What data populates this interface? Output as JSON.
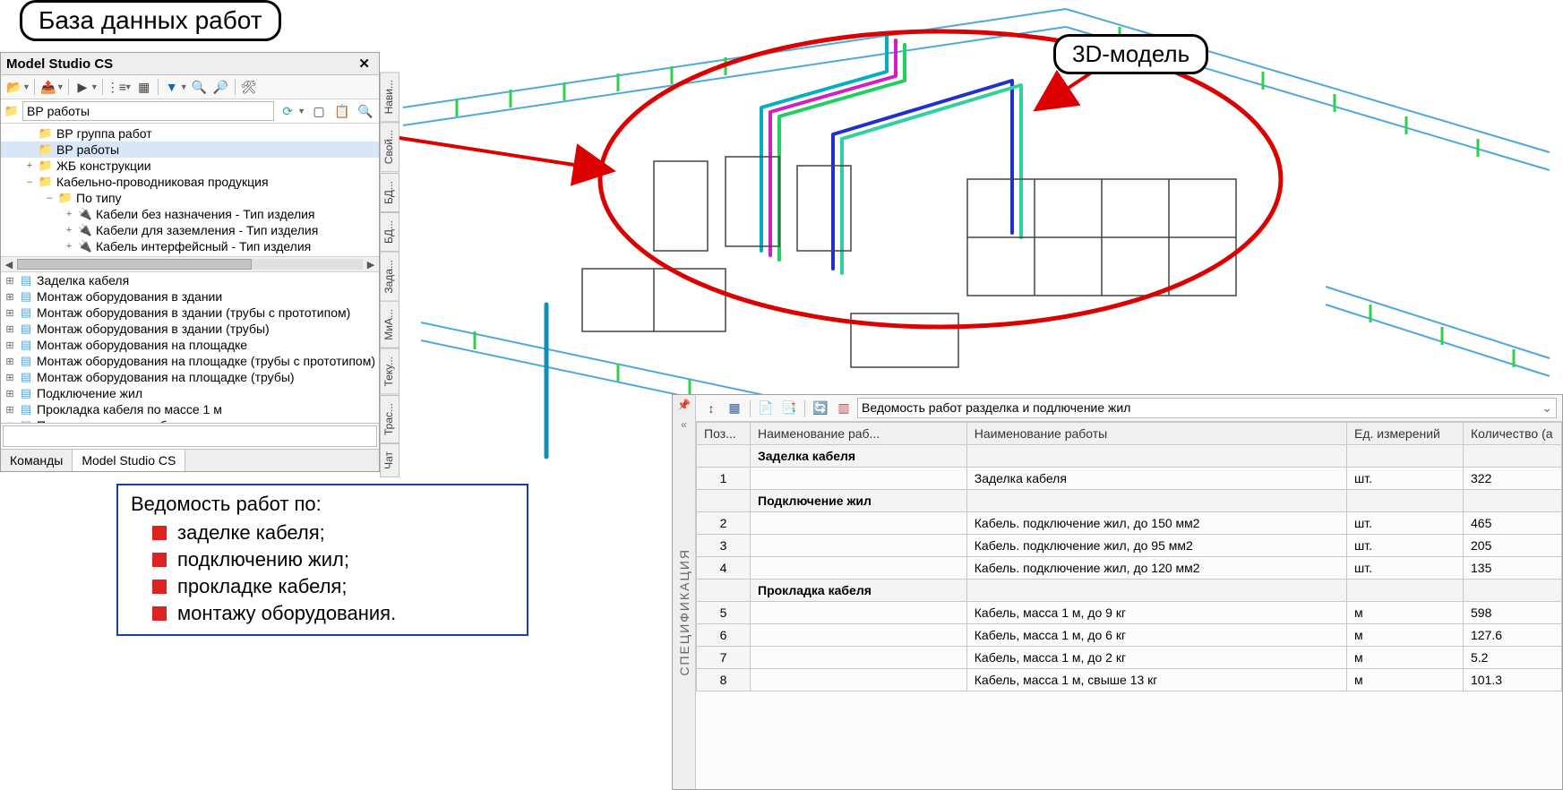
{
  "callouts": {
    "database": "База данных работ",
    "model3d": "3D-модель"
  },
  "panel": {
    "title": "Model Studio CS",
    "search_value": "ВР работы",
    "tree": [
      {
        "lvl": 1,
        "icon": "folder",
        "toggle": "",
        "label": "ВР группа работ"
      },
      {
        "lvl": 1,
        "icon": "folder",
        "toggle": "",
        "label": "ВР работы",
        "sel": true
      },
      {
        "lvl": 1,
        "icon": "folder",
        "toggle": "+",
        "label": "ЖБ конструкции"
      },
      {
        "lvl": 1,
        "icon": "folder",
        "toggle": "–",
        "label": "Кабельно-проводниковая продукция"
      },
      {
        "lvl": 2,
        "icon": "folder",
        "toggle": "–",
        "label": "По типу"
      },
      {
        "lvl": 3,
        "icon": "cable",
        "toggle": "+",
        "label": "Кабели без назначения - Тип изделия"
      },
      {
        "lvl": 3,
        "icon": "cable",
        "toggle": "+",
        "label": "Кабели для заземления - Тип изделия"
      },
      {
        "lvl": 3,
        "icon": "cable",
        "toggle": "+",
        "label": "Кабель интерфейсный - Тип изделия"
      }
    ],
    "bottom_list": [
      "Заделка кабеля",
      "Монтаж оборудования в здании",
      "Монтаж оборудования в здании (трубы с прототипом)",
      "Монтаж оборудования в здании (трубы)",
      "Монтаж оборудования на площадке",
      "Монтаж оборудования на площадке (трубы с прототипом)",
      "Монтаж оборудования на площадке (трубы)",
      "Подключение жил",
      "Прокладка кабеля по массе 1 м",
      "Пусконаладочные работы"
    ],
    "tabs": {
      "commands": "Команды",
      "studio": "Model Studio CS"
    },
    "side_tabs": [
      "Нави...",
      "Свой...",
      "БД...",
      "БД...",
      "Зада...",
      "МиА...",
      "Теку...",
      "Трас...",
      "Чат"
    ]
  },
  "legend": {
    "title": "Ведомость работ по:",
    "items": [
      "заделке кабеля;",
      "подключению жил;",
      "прокладке кабеля;",
      "монтажу оборудования."
    ]
  },
  "spec": {
    "side_label": "СПЕЦИФИКАЦИЯ",
    "dropdown": "Ведомость работ разделка и подлючение жил",
    "columns": {
      "pos": "Поз...",
      "group": "Наименование раб...",
      "name": "Наименование работы",
      "unit": "Ед. измерений",
      "qty": "Количество (а"
    },
    "rows": [
      {
        "type": "group",
        "group": "Заделка кабеля"
      },
      {
        "type": "data",
        "pos": "1",
        "name": "Заделка кабеля",
        "unit": "шт.",
        "qty": "322"
      },
      {
        "type": "group",
        "group": "Подключение жил"
      },
      {
        "type": "data",
        "pos": "2",
        "name": "Кабель. подключение жил, до 150 мм2",
        "unit": "шт.",
        "qty": "465"
      },
      {
        "type": "data",
        "pos": "3",
        "name": "Кабель. подключение жил, до 95 мм2",
        "unit": "шт.",
        "qty": "205"
      },
      {
        "type": "data",
        "pos": "4",
        "name": "Кабель. подключение жил, до 120 мм2",
        "unit": "шт.",
        "qty": "135"
      },
      {
        "type": "group",
        "group": "Прокладка кабеля"
      },
      {
        "type": "data",
        "pos": "5",
        "name": "Кабель, масса 1 м, до 9 кг",
        "unit": "м",
        "qty": "598"
      },
      {
        "type": "data",
        "pos": "6",
        "name": "Кабель, масса 1 м, до 6 кг",
        "unit": "м",
        "qty": "127.6"
      },
      {
        "type": "data",
        "pos": "7",
        "name": "Кабель, масса 1 м, до 2 кг",
        "unit": "м",
        "qty": "5.2"
      },
      {
        "type": "data",
        "pos": "8",
        "name": "Кабель, масса 1 м, свыше 13 кг",
        "unit": "м",
        "qty": "101.3"
      }
    ]
  }
}
